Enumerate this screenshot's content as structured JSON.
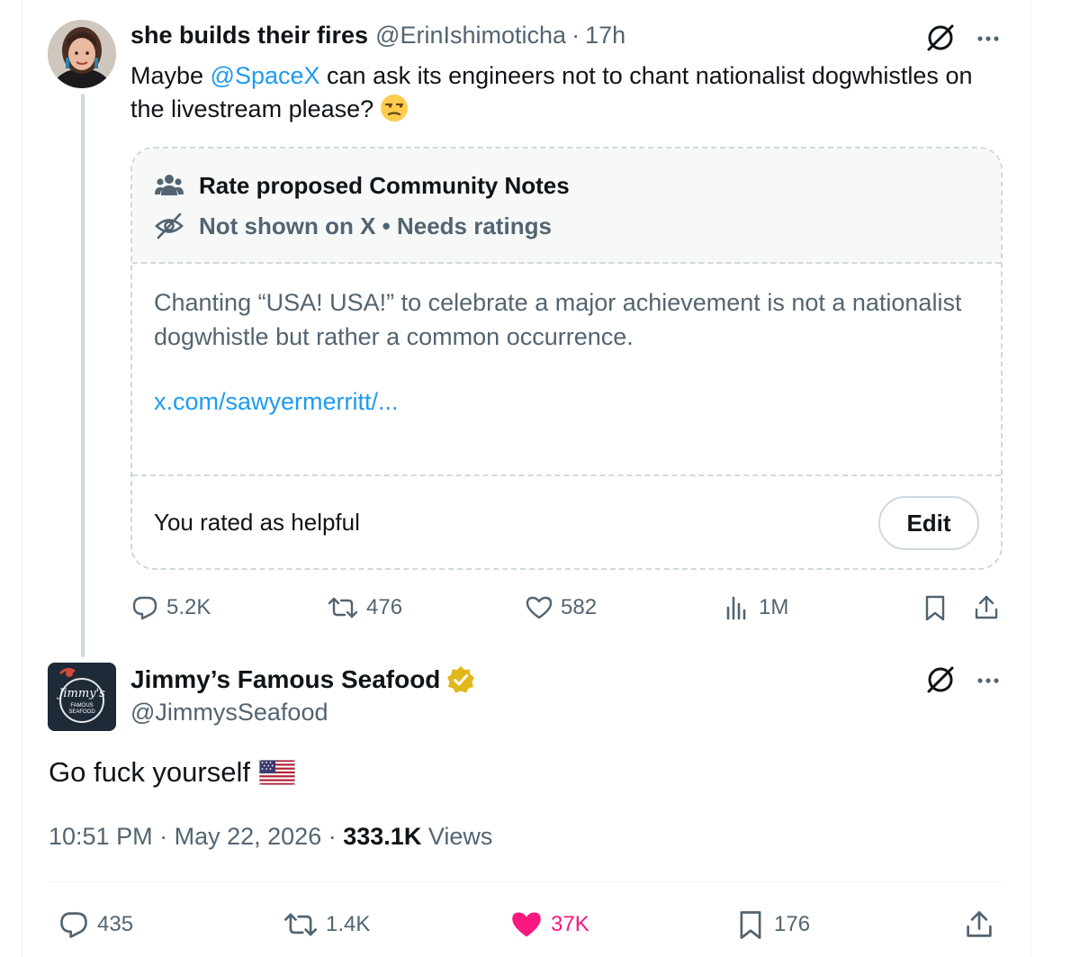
{
  "tweet1": {
    "display_name": "she builds their fires",
    "handle": "@ErinIshimoticha",
    "separator": "·",
    "time": "17h",
    "text_before": "Maybe ",
    "mention": "@SpaceX",
    "text_after": " can ask its engineers not to chant nationalist dogwhistles on the livestream please?",
    "emoji": "unamused-face",
    "community_note": {
      "title": "Rate proposed Community Notes",
      "status": "Not shown on X • Needs ratings",
      "body": "Chanting “USA! USA!” to celebrate a major achievement is not a nationalist dogwhistle but rather a common occurrence.",
      "link": "x.com/sawyermerritt/...",
      "rated_text": "You rated as helpful",
      "edit_label": "Edit"
    },
    "actions": {
      "replies": "5.2K",
      "reposts": "476",
      "likes": "582",
      "views": "1M"
    }
  },
  "tweet2": {
    "display_name": "Jimmy’s Famous Seafood",
    "handle": "@JimmysSeafood",
    "verified": "gold-checkmark",
    "text": "Go fuck yourself",
    "emoji": "us-flag",
    "time": "10:51 PM",
    "date": "May 22, 2026",
    "views_count": "333.1K",
    "views_label": "Views",
    "separator": "·",
    "actions": {
      "replies": "435",
      "reposts": "1.4K",
      "likes": "37K",
      "bookmarks": "176"
    },
    "avatar_logo_text": {
      "script": "Jimmy's",
      "line2": "FAMOUS",
      "line3": "SEAFOOD"
    }
  },
  "colors": {
    "text": "#0f1419",
    "secondary": "#536471",
    "link": "#1d9bf0",
    "like_active": "#f91880",
    "border": "#cfd9de",
    "verified_gold": "#e2b719"
  }
}
